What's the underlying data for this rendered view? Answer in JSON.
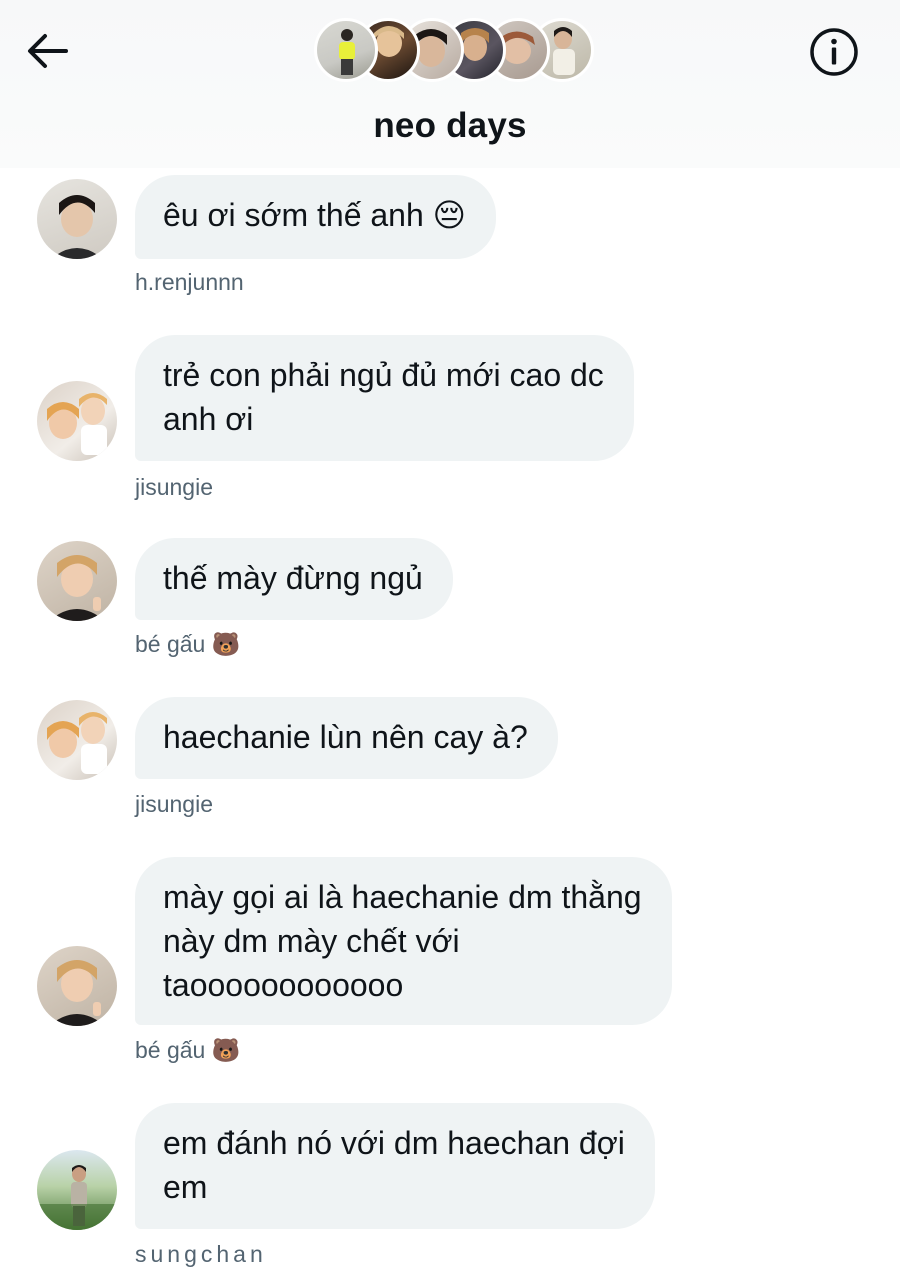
{
  "header": {
    "title": "neo days",
    "back_icon": "arrow-left-icon",
    "info_icon": "info-circle-icon"
  },
  "colors": {
    "bubble": "#eff3f4",
    "text": "#0f1419",
    "secondary_text": "#536471",
    "header_bg": "#f7f8f9"
  },
  "messages": [
    {
      "text": "êu ơi sớm thế anh 😔",
      "sender": "h.renjunnn"
    },
    {
      "text": "trẻ con phải ngủ đủ mới cao dc\nanh ơi",
      "sender": "jisungie"
    },
    {
      "text": "thế mày đừng ngủ",
      "sender": "bé gấu 🐻"
    },
    {
      "text": "haechanie lùn nên cay à?",
      "sender": "jisungie"
    },
    {
      "text": "mày gọi ai là haechanie dm thằng\nnày dm mày chết với\ntaoooooooooooo",
      "sender": "bé gấu 🐻"
    },
    {
      "text": "em đánh nó với dm haechan đợi\nem",
      "sender": "sungchan"
    }
  ]
}
